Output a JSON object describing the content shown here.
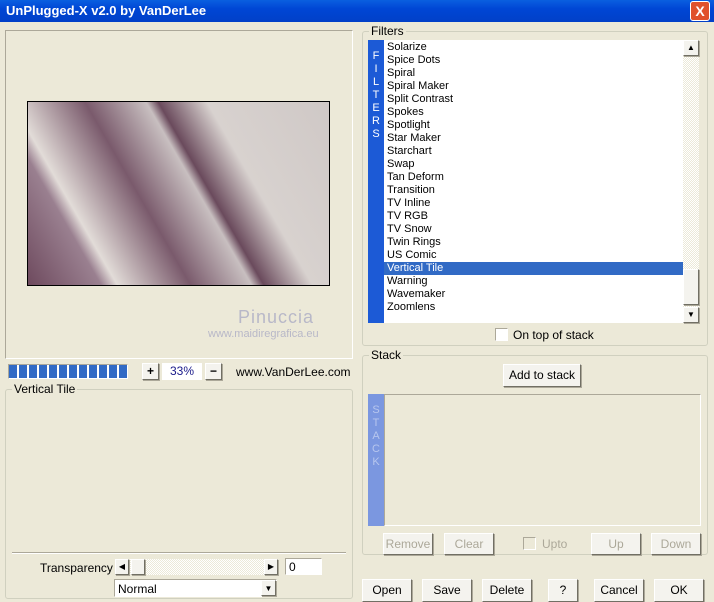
{
  "window": {
    "title": "UnPlugged-X v2.0 by VanDerLee",
    "close": "X"
  },
  "preview": {
    "watermark_name": "Pinuccia",
    "watermark_url": "www.maidiregrafica.eu"
  },
  "zoom": {
    "progress_percent": 100,
    "plus": "+",
    "value": "33%",
    "minus": "−",
    "website": "www.VanDerLee.com"
  },
  "params": {
    "group_label": "Vertical Tile",
    "transparency_label": "Transparency",
    "transparency_value": "0",
    "blend_mode": "Normal"
  },
  "filters": {
    "group_label": "Filters",
    "strip": "FILTERS",
    "items": [
      "Solarize",
      "Spice Dots",
      "Spiral",
      "Spiral Maker",
      "Split Contrast",
      "Spokes",
      "Spotlight",
      "Star Maker",
      "Starchart",
      "Swap",
      "Tan Deform",
      "Transition",
      "TV Inline",
      "TV RGB",
      "TV Snow",
      "Twin Rings",
      "US Comic",
      "Vertical Tile",
      "Warning",
      "Wavemaker",
      "Zoomlens"
    ],
    "selected": "Vertical Tile",
    "on_top_label": "On top of stack"
  },
  "stack": {
    "group_label": "Stack",
    "add": "Add to stack",
    "strip": "STACK",
    "remove": "Remove",
    "clear": "Clear",
    "upto": "Upto",
    "up": "Up",
    "down": "Down"
  },
  "footer": {
    "open": "Open",
    "save": "Save",
    "delete": "Delete",
    "help": "?",
    "cancel": "Cancel",
    "ok": "OK"
  }
}
